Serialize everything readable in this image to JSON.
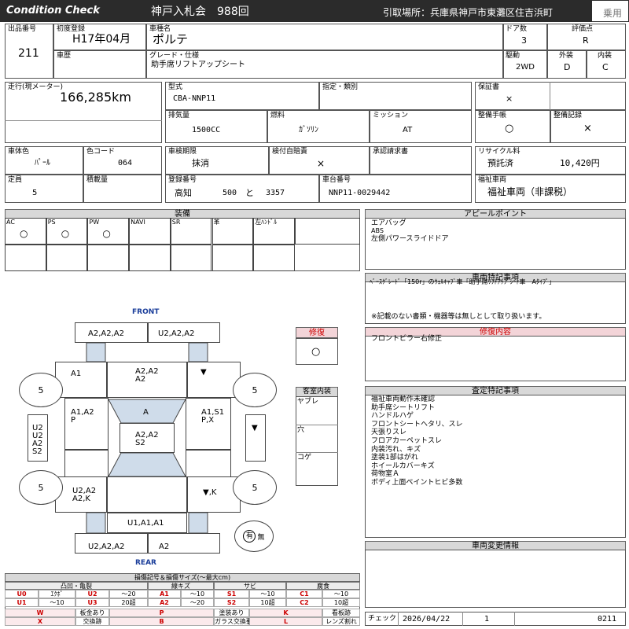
{
  "header": {
    "title_en": "Condition Check",
    "auction": "神戸入札会　988回",
    "pickup": "引取場所：兵庫県神戸市東灘区住吉浜町",
    "category": "乗用"
  },
  "fields": {
    "lot_no": {
      "label": "出品番号",
      "value": "211"
    },
    "first_reg": {
      "label": "初度登録",
      "value": "H17年04月"
    },
    "car_name": {
      "label": "車種名",
      "value": "ポルテ"
    },
    "doors": {
      "label": "ドア数",
      "value": "3"
    },
    "grade_score": {
      "label": "評価点",
      "value": "R"
    },
    "history": {
      "label": "車歴",
      "value": ""
    },
    "grade": {
      "label": "グレード・仕様",
      "value": "助手席リフトアップシート"
    },
    "drive": {
      "label": "駆動",
      "value": "2WD"
    },
    "exterior": {
      "label": "外装",
      "value": "D"
    },
    "interior": {
      "label": "内装",
      "value": "C"
    },
    "mileage": {
      "label": "走行(現メーター)",
      "value": "166,285km"
    },
    "model": {
      "label": "型式",
      "value": "CBA-NNP11"
    },
    "designation": {
      "label": "指定・類別",
      "value": ""
    },
    "warranty": {
      "label": "保証書",
      "value": "×"
    },
    "displacement": {
      "label": "排気量",
      "value": "1500CC"
    },
    "fuel": {
      "label": "燃料",
      "value": "ｶﾞｿﾘﾝ"
    },
    "transmission": {
      "label": "ミッション",
      "value": "AT"
    },
    "maint_book": {
      "label": "整備手帳",
      "value": "○"
    },
    "maint_record": {
      "label": "整備記録",
      "value": "×"
    },
    "color": {
      "label": "車体色",
      "value": "ﾊﾟｰﾙ"
    },
    "color_code": {
      "label": "色コード",
      "value": "064"
    },
    "inspection": {
      "label": "車検期限",
      "value": "抹消"
    },
    "insurance": {
      "label": "検付自賠責",
      "value": "×"
    },
    "approval": {
      "label": "承認請求書",
      "value": ""
    },
    "recycle": {
      "label": "リサイクル料",
      "status": "預託済",
      "amount": "10,420円"
    },
    "capacity": {
      "label": "定員",
      "value": "5"
    },
    "load": {
      "label": "積載量",
      "value": ""
    },
    "plate": {
      "label": "登録番号",
      "region": "高知",
      "cls": "500",
      "kana": "と",
      "num": "3357"
    },
    "chassis": {
      "label": "車台番号",
      "value": "NNP11-0029442"
    },
    "welfare": {
      "label": "福祉車両",
      "value": "福祉車両（非課税）"
    }
  },
  "equipment": {
    "title": "装備",
    "headers": [
      "AC",
      "PS",
      "PW",
      "NAVI",
      "SR",
      "革",
      "左ﾊﾝﾄﾞﾙ"
    ],
    "values": [
      "○",
      "○",
      "○",
      "",
      "",
      "",
      ""
    ]
  },
  "appeal": {
    "title": "アピールポイント",
    "lines": [
      "エアバッグ",
      "ABS",
      "左側パワースライドドア"
    ]
  },
  "special": {
    "title": "車両特記事項",
    "line1": "ﾍﾞｰｽｸﾞﾚｰﾄﾞ「150r」のｳｪﾙｷｬﾌﾞ車「助手席ﾘﾌﾄｱｯﾌﾟｼｰﾄ車　Aﾀｲﾌﾟ」",
    "note": "※記載のない書類・機器等は無しとして取り扱います。"
  },
  "repair": {
    "title": "修復",
    "value": "○",
    "content_title": "修復内容",
    "content": "フロントピラー右修正"
  },
  "interior_panel": {
    "title": "客室内装",
    "items": [
      "ヤブレ",
      "穴",
      "コゲ"
    ]
  },
  "inspection_notes": {
    "title": "査定特記事項",
    "lines": [
      "福祉車両動作未確認",
      "助手席シートリフト",
      "ハンドルハゲ",
      "フロントシートヘタリ、スレ",
      "天張りスレ",
      "フロアカーペットスレ",
      "内装汚れ、キズ",
      "塗装1部はがれ",
      "ホイールカバーキズ",
      "荷物室Ａ",
      "ボディ上面ペイントヒビ多数"
    ]
  },
  "change_info": {
    "title": "車両変更情報"
  },
  "diagram": {
    "front": "FRONT",
    "rear": "REAR",
    "trunk": "trunk",
    "tires": [
      "5",
      "5",
      "5",
      "5",
      "5"
    ],
    "cells": {
      "front_bumper_l": "A2,A2,A2",
      "front_bumper_r": "U2,A2,A2",
      "fender_fl": "A1",
      "hood": "A2,A2\nA2",
      "fender_fr": "▼",
      "door_fl": "A1,A2\nP",
      "windshield": "A",
      "door_fr": "A1,S1\nP,X",
      "side_l": "U2\nU2\nA2\nS2",
      "roof": "A2,A2\nS2",
      "side_r": "▼",
      "door_rl": "U2,A2\nA2,K",
      "door_rr": "▼,K",
      "rear_panel": "U1,A1,A1",
      "rear_bumper_l": "U2,A2,A2",
      "rear_bumper_r": "A2",
      "spare_label": "有",
      "spare_none": "無"
    }
  },
  "legend": {
    "title": "損傷記号＆損傷サイズ(～最大cm)",
    "groups": [
      "凸凹・亀裂",
      "線キズ",
      "サビ",
      "腐食"
    ],
    "row1": [
      [
        "U0",
        "ｴｸﾎﾞ"
      ],
      [
        "U2",
        "～20"
      ],
      [
        "A1",
        "～10"
      ],
      [
        "S1",
        "～10"
      ],
      [
        "C1",
        "～10"
      ]
    ],
    "row2": [
      [
        "U1",
        "～10"
      ],
      [
        "U3",
        "20超"
      ],
      [
        "A2",
        "～20"
      ],
      [
        "S2",
        "10超"
      ],
      [
        "C2",
        "10超"
      ]
    ],
    "row3": [
      [
        "W",
        "板金あり"
      ],
      [
        "P",
        "塗装あり"
      ],
      [
        "K",
        "看板跡"
      ]
    ],
    "row4": [
      [
        "X",
        "交換跡"
      ],
      [
        "B",
        "ガラス交換要す"
      ],
      [
        "L",
        "レンズ割れ"
      ]
    ]
  },
  "footer": {
    "check_label": "チェック",
    "date": "2026/04/22",
    "count": "1",
    "code": "0211"
  }
}
